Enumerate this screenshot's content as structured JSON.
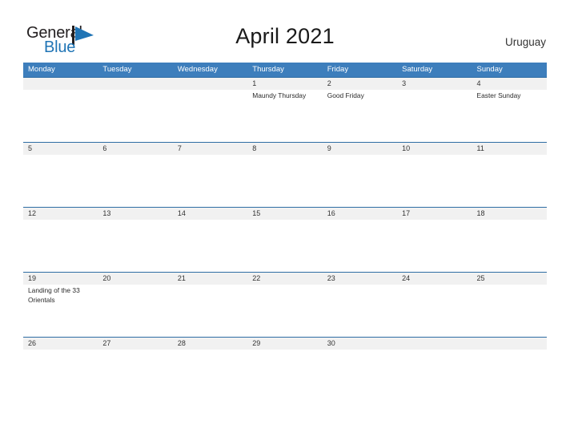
{
  "brand": {
    "word_one": "General",
    "word_two": "Blue",
    "flag_icon": "blue-triangle-flag-icon",
    "color_dark": "#231f20",
    "color_blue": "#1f74b5"
  },
  "header": {
    "title": "April 2021",
    "country": "Uruguay"
  },
  "colors": {
    "header_blue": "#3d7ebc",
    "row_divider_blue": "#2e6da4",
    "day_band_gray": "#f1f1f1",
    "background": "#ffffff",
    "text": "#333333"
  },
  "calendar": {
    "weekdays": [
      "Monday",
      "Tuesday",
      "Wednesday",
      "Thursday",
      "Friday",
      "Saturday",
      "Sunday"
    ],
    "weeks": [
      {
        "days": [
          {
            "date": "",
            "event": ""
          },
          {
            "date": "",
            "event": ""
          },
          {
            "date": "",
            "event": ""
          },
          {
            "date": "1",
            "event": "Maundy Thursday"
          },
          {
            "date": "2",
            "event": "Good Friday"
          },
          {
            "date": "3",
            "event": ""
          },
          {
            "date": "4",
            "event": "Easter Sunday"
          }
        ]
      },
      {
        "days": [
          {
            "date": "5",
            "event": ""
          },
          {
            "date": "6",
            "event": ""
          },
          {
            "date": "7",
            "event": ""
          },
          {
            "date": "8",
            "event": ""
          },
          {
            "date": "9",
            "event": ""
          },
          {
            "date": "10",
            "event": ""
          },
          {
            "date": "11",
            "event": ""
          }
        ]
      },
      {
        "days": [
          {
            "date": "12",
            "event": ""
          },
          {
            "date": "13",
            "event": ""
          },
          {
            "date": "14",
            "event": ""
          },
          {
            "date": "15",
            "event": ""
          },
          {
            "date": "16",
            "event": ""
          },
          {
            "date": "17",
            "event": ""
          },
          {
            "date": "18",
            "event": ""
          }
        ]
      },
      {
        "days": [
          {
            "date": "19",
            "event": "Landing of the 33 Orientals"
          },
          {
            "date": "20",
            "event": ""
          },
          {
            "date": "21",
            "event": ""
          },
          {
            "date": "22",
            "event": ""
          },
          {
            "date": "23",
            "event": ""
          },
          {
            "date": "24",
            "event": ""
          },
          {
            "date": "25",
            "event": ""
          }
        ]
      },
      {
        "days": [
          {
            "date": "26",
            "event": ""
          },
          {
            "date": "27",
            "event": ""
          },
          {
            "date": "28",
            "event": ""
          },
          {
            "date": "29",
            "event": ""
          },
          {
            "date": "30",
            "event": ""
          },
          {
            "date": "",
            "event": ""
          },
          {
            "date": "",
            "event": ""
          }
        ]
      }
    ]
  }
}
